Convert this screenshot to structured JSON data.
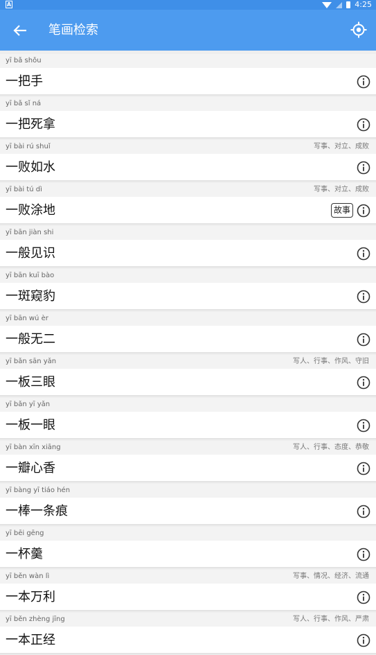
{
  "status_bar": {
    "time": "4:25",
    "left_icon_text": "A"
  },
  "app_bar": {
    "title": "笔画检索",
    "back_icon": "arrow-left-icon",
    "locate_icon": "crosshair-icon"
  },
  "items": [
    {
      "pinyin": "yī bǎ shǒu",
      "word": "一把手",
      "tags": "",
      "badge": ""
    },
    {
      "pinyin": "yī bǎ sǐ ná",
      "word": "一把死拿",
      "tags": "",
      "badge": ""
    },
    {
      "pinyin": "yī bài rú shuǐ",
      "word": "一败如水",
      "tags": "写事、对立、成败",
      "badge": ""
    },
    {
      "pinyin": "yī bài tú dì",
      "word": "一败涂地",
      "tags": "写事、对立、成败",
      "badge": "故事"
    },
    {
      "pinyin": "yī bān jiàn shi",
      "word": "一般见识",
      "tags": "",
      "badge": ""
    },
    {
      "pinyin": "yī bān kuī bào",
      "word": "一斑窥豹",
      "tags": "",
      "badge": ""
    },
    {
      "pinyin": "yī bān wú èr",
      "word": "一般无二",
      "tags": "",
      "badge": ""
    },
    {
      "pinyin": "yī bǎn sān yǎn",
      "word": "一板三眼",
      "tags": "写人、行事、作风、守旧",
      "badge": ""
    },
    {
      "pinyin": "yī bǎn yī yǎn",
      "word": "一板一眼",
      "tags": "",
      "badge": ""
    },
    {
      "pinyin": "yī bàn xīn xiāng",
      "word": "一瓣心香",
      "tags": "写人、行事、态度、恭敬",
      "badge": ""
    },
    {
      "pinyin": "yī bàng yī tiáo hén",
      "word": "一棒一条痕",
      "tags": "",
      "badge": ""
    },
    {
      "pinyin": "yī bēi gēng",
      "word": "一杯羹",
      "tags": "",
      "badge": ""
    },
    {
      "pinyin": "yī běn wàn lì",
      "word": "一本万利",
      "tags": "写事、情况、经济、流通",
      "badge": ""
    },
    {
      "pinyin": "yī běn zhèng jīng",
      "word": "一本正经",
      "tags": "写人、行事、作风、严肃",
      "badge": ""
    }
  ]
}
